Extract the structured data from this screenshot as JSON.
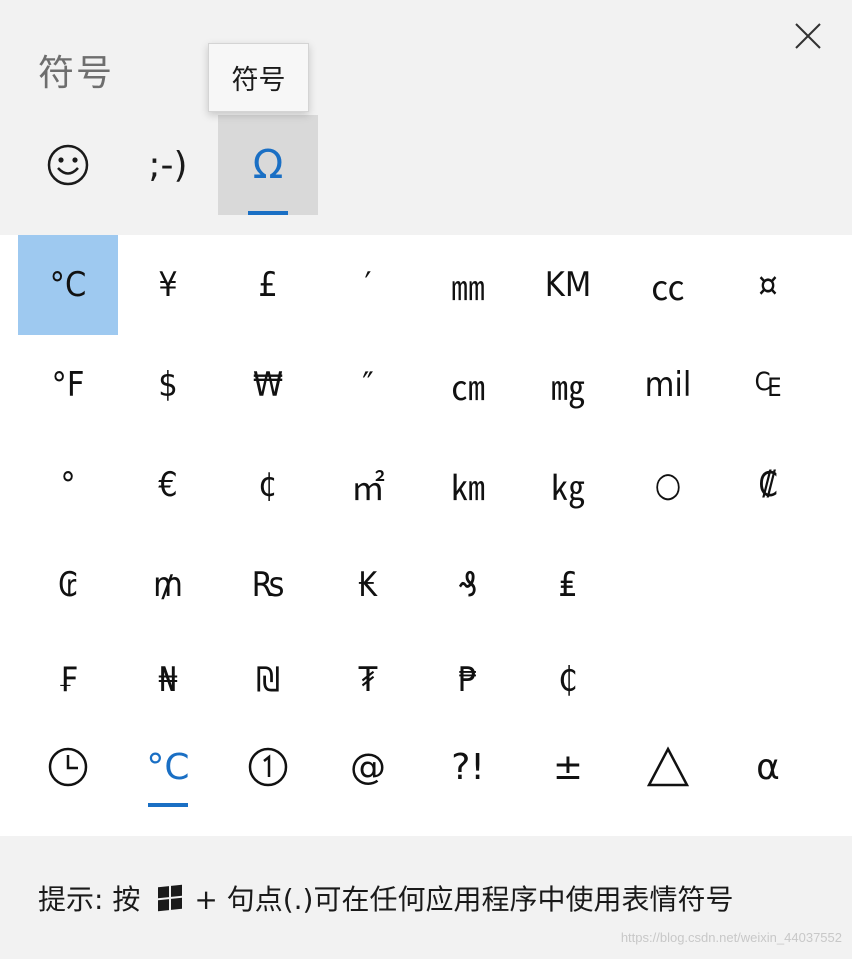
{
  "panel": {
    "title": "符号",
    "tooltip": "符号"
  },
  "tabs": [
    {
      "name": "emoji",
      "icon": "smiley-icon",
      "label": "☺"
    },
    {
      "name": "kaomoji",
      "icon": "kaomoji-icon",
      "label": ";-)"
    },
    {
      "name": "symbols",
      "icon": "omega-icon",
      "label": "Ω",
      "active": true
    }
  ],
  "symbols": [
    [
      "°C",
      "¥",
      "£",
      "′",
      "㎜",
      "KM",
      "㏄",
      "¤"
    ],
    [
      "°F",
      "$",
      "₩",
      "″",
      "㎝",
      "㎎",
      "mil",
      "₠"
    ],
    [
      "°",
      "€",
      "¢",
      "㎡",
      "㎞",
      "㎏",
      "○",
      "₡"
    ],
    [
      "₢",
      "₥",
      "₨",
      "₭",
      "₰",
      "₤",
      "",
      ""
    ],
    [
      "₣",
      "₦",
      "₪",
      "₮",
      "₱",
      "₵",
      "",
      ""
    ]
  ],
  "categories": [
    {
      "name": "recent",
      "icon": "clock-icon",
      "label": ""
    },
    {
      "name": "currency-units",
      "icon": "celsius-icon",
      "label": "°C",
      "active": true
    },
    {
      "name": "enclosed",
      "icon": "circled-one-icon",
      "label": "①"
    },
    {
      "name": "punctuation",
      "icon": "at-icon",
      "label": "@"
    },
    {
      "name": "interrobang",
      "icon": "interrobang-icon",
      "label": "?!"
    },
    {
      "name": "math",
      "icon": "plus-minus-icon",
      "label": "±"
    },
    {
      "name": "geometric",
      "icon": "triangle-icon",
      "label": "△"
    },
    {
      "name": "greek",
      "icon": "alpha-icon",
      "label": "α"
    }
  ],
  "hint": {
    "prefix": "提示: 按",
    "suffix": "+ 句点(.)可在任何应用程序中使用表情符号"
  },
  "watermark": "https://blog.csdn.net/weixin_44037552",
  "colors": {
    "accent": "#1a6fc4",
    "selected_bg": "#9ec9f0",
    "panel_bg": "#f2f2f2"
  }
}
